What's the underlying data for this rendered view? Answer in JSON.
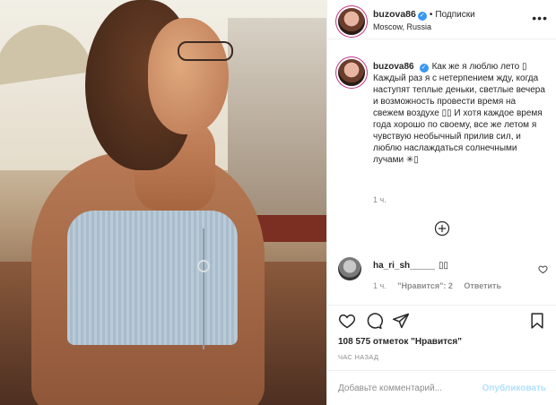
{
  "post": {
    "photo_alt": "Photo of a woman in a blue knit crop top at sunset"
  },
  "header": {
    "username": "buzova86",
    "verified_icon": "verified-badge-icon",
    "separator": "•",
    "follow_label": "Подписки",
    "location": "Moscow, Russia",
    "more_icon": "more-options-icon",
    "more_glyph": "•••"
  },
  "caption": {
    "username": "buzova86",
    "text": "Как же я люблю лето ▯ Каждый раз я с нетерпением жду, когда наступят теплые деньки, светлые вечера и возможность провести время на свежем воздухе ▯▯ И хотя каждое время года хорошо по своему, все же летом я чувствую необычный прилив сил, и люблю наслаждаться солнечными лучами ✳▯",
    "time": "1 ч."
  },
  "load_more_icon": "plus-circle-icon",
  "comments": [
    {
      "username": "ha_ri_sh_____",
      "text": "▯▯",
      "time": "1 ч.",
      "likes_label": "\"Нравится\": 2",
      "reply_label": "Ответить"
    }
  ],
  "actions": {
    "like_icon": "heart-icon",
    "comment_icon": "comment-icon",
    "share_icon": "share-icon",
    "save_icon": "bookmark-icon"
  },
  "likes_text": "108 575 отметок \"Нравится\"",
  "post_time": "ЧАС НАЗАД",
  "composer": {
    "placeholder": "Добавьте комментарий...",
    "publish_label": "Опубликовать"
  },
  "colors": {
    "link_blue": "#3897f0",
    "publish_disabled": "#b2dffc",
    "secondary_text": "#8e8e8e",
    "border": "#efefef"
  }
}
